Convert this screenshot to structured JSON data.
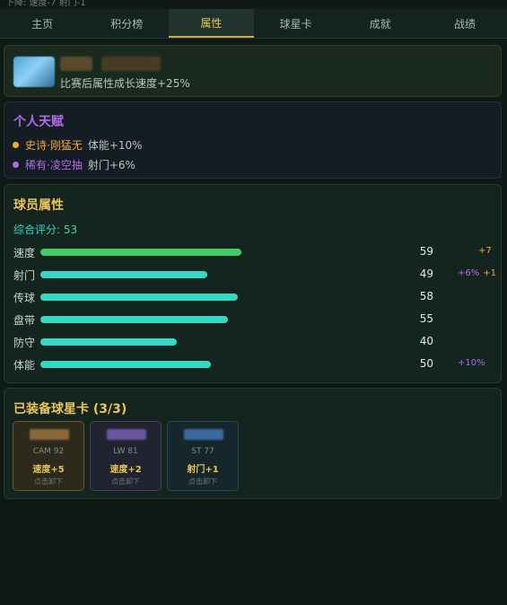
{
  "header": {
    "partial_text": "下降: 速度-7 射门-1"
  },
  "tabs": [
    {
      "label": "主页",
      "active": false
    },
    {
      "label": "积分榜",
      "active": false
    },
    {
      "label": "属性",
      "active": true
    },
    {
      "label": "球星卡",
      "active": false
    },
    {
      "label": "成就",
      "active": false
    },
    {
      "label": "战绩",
      "active": false
    }
  ],
  "growth": {
    "text": "比赛后属性成长速度+25%"
  },
  "talents": {
    "title": "个人天赋",
    "items": [
      {
        "name": "史诗·刚猛无",
        "effect": "体能+10%",
        "color": "#f0a93a"
      },
      {
        "name": "稀有·凌空抽",
        "effect": "射门+6%",
        "color": "#b46ae8"
      }
    ]
  },
  "attributes": {
    "title": "球员属性",
    "overall_label": "综合评分: 53",
    "max_value": 100,
    "stats": [
      {
        "label": "速度",
        "value": "59",
        "bar": 59,
        "bonus_pct": "",
        "bonus_flat": "+7",
        "bar_color": "#3fce63"
      },
      {
        "label": "射门",
        "value": "49",
        "bar": 49,
        "bonus_pct": "+6%",
        "bonus_flat": "+1",
        "bar_color": "#35d8c4"
      },
      {
        "label": "传球",
        "value": "58",
        "bar": 58,
        "bonus_pct": "",
        "bonus_flat": "",
        "bar_color": "#35d8c4"
      },
      {
        "label": "盘带",
        "value": "55",
        "bar": 55,
        "bonus_pct": "",
        "bonus_flat": "",
        "bar_color": "#35d8c4"
      },
      {
        "label": "防守",
        "value": "40",
        "bar": 40,
        "bonus_pct": "",
        "bonus_flat": "",
        "bar_color": "#35d8c4"
      },
      {
        "label": "体能",
        "value": "50",
        "bar": 50,
        "bonus_pct": "+10%",
        "bonus_flat": "",
        "bar_color": "#35d8c4"
      }
    ]
  },
  "equipped": {
    "title": "已装备球星卡 (3/3)",
    "cards": [
      {
        "position": "CAM 92",
        "bonus": "速度+5",
        "hint": "点击卸下",
        "border": "#6a5a26",
        "bg": "#2b2a1c",
        "bonus_color": "#e9c55a",
        "img_color": "#8a6a3a"
      },
      {
        "position": "LW 81",
        "bonus": "速度+2",
        "hint": "点击卸下",
        "border": "#44405a",
        "bg": "#222331",
        "bonus_color": "#e9c55a",
        "img_color": "#6a55a0"
      },
      {
        "position": "ST 77",
        "bonus": "射门+1",
        "hint": "点击卸下",
        "border": "#234a55",
        "bg": "#16272b",
        "bonus_color": "#e9c55a",
        "img_color": "#3a6aa0"
      }
    ]
  },
  "colors": {
    "accent_gold": "#e9c55a",
    "accent_teal": "#35d8c4",
    "accent_purple": "#b46ae8",
    "bonus_orange": "#f0a93a",
    "bonus_purple": "#b46ae8"
  }
}
